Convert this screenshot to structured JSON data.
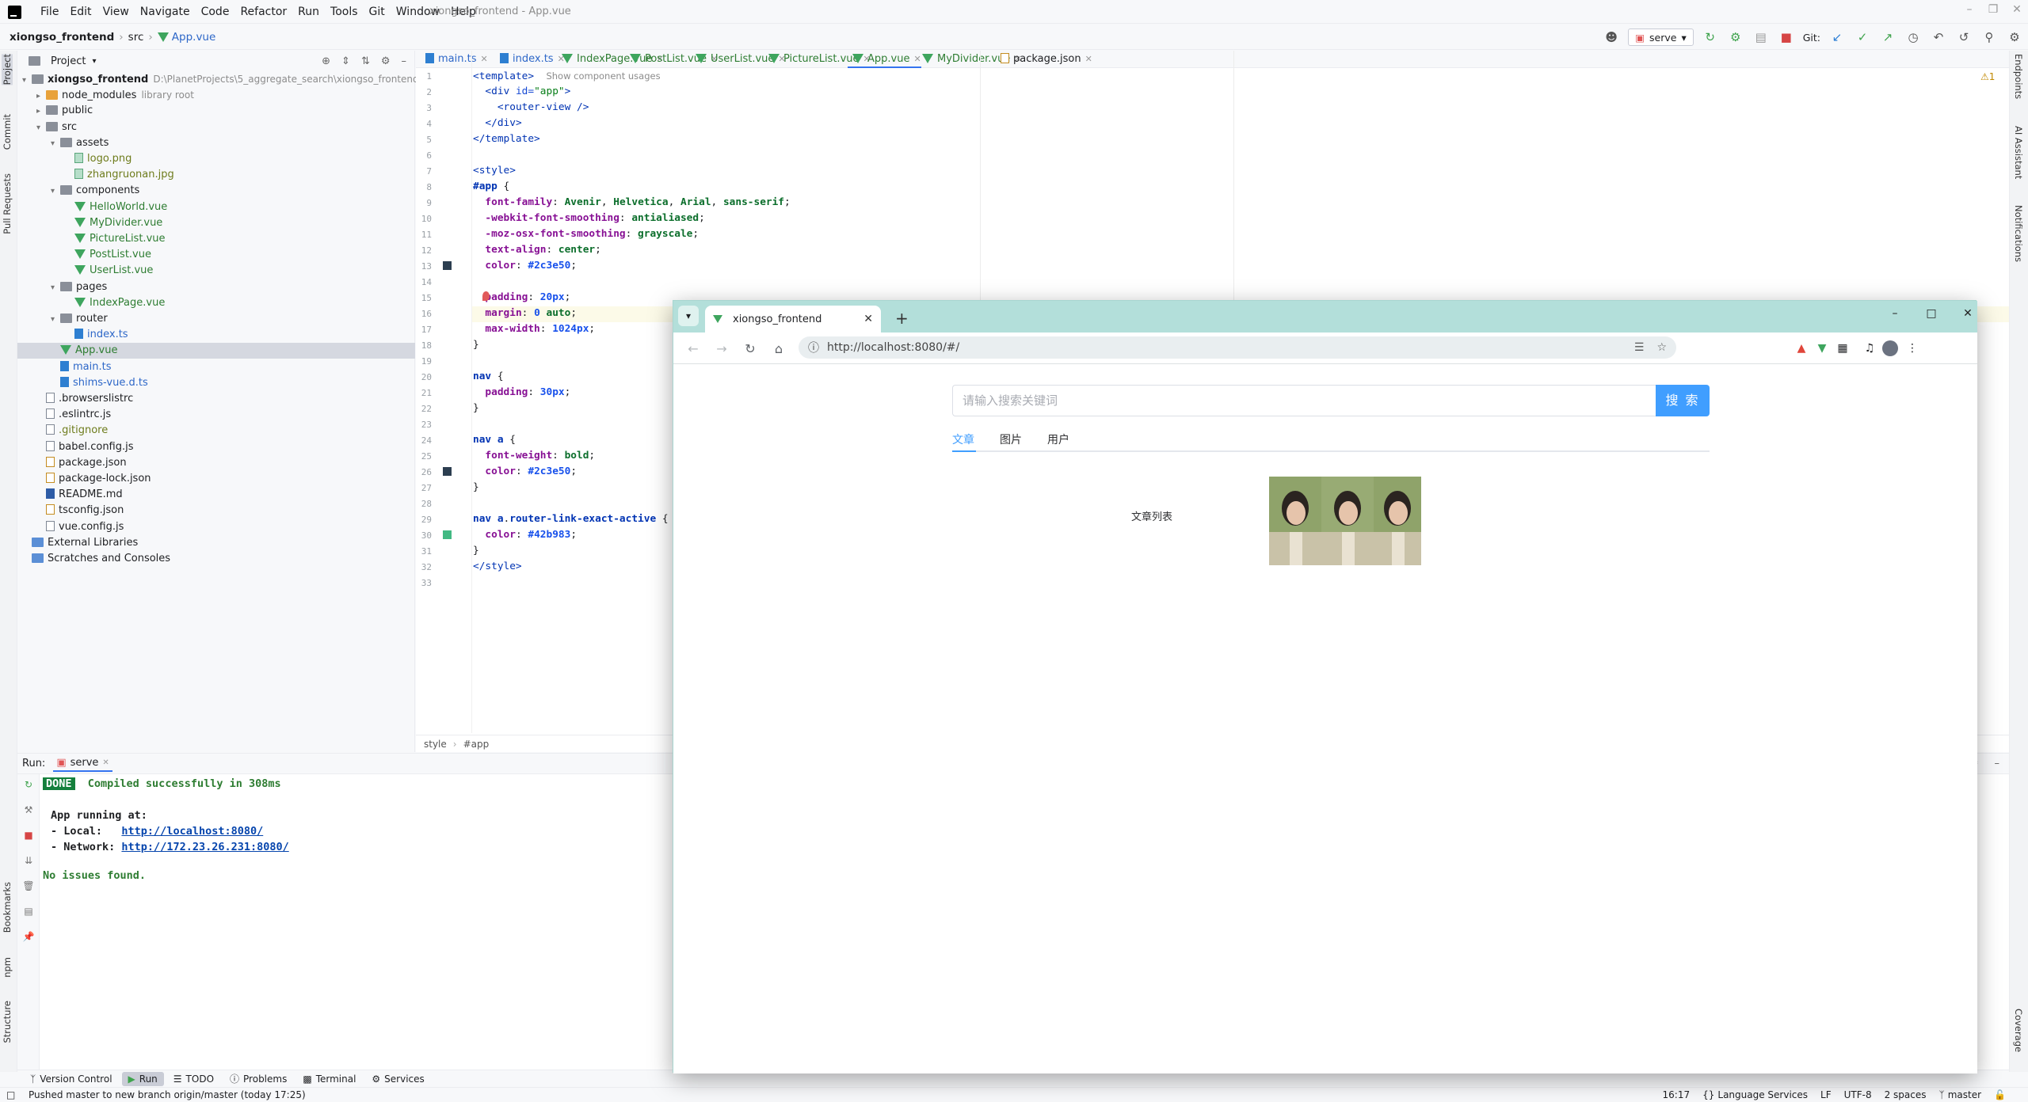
{
  "window": {
    "title": "xiongso_frontend - App.vue"
  },
  "menu": [
    "File",
    "Edit",
    "View",
    "Navigate",
    "Code",
    "Refactor",
    "Run",
    "Tools",
    "Git",
    "Window",
    "Help"
  ],
  "breadcrumb": {
    "project": "xiongso_frontend",
    "folder": "src",
    "file": "App.vue"
  },
  "toolbar": {
    "run_config": "serve",
    "git_label": "Git:"
  },
  "left_stripe": [
    "Project",
    "Commit",
    "Pull Requests",
    "Bookmarks",
    "npm",
    "Structure"
  ],
  "right_stripe": [
    "Endpoints",
    "AI Assistant",
    "Notifications",
    "Coverage"
  ],
  "project_panel": {
    "title": "Project",
    "tree": [
      {
        "label": "xiongso_frontend",
        "extra": "D:\\PlanetProjects\\5_aggregate_search\\xiongso_frontend",
        "type": "root"
      },
      {
        "label": "node_modules",
        "extra": "library root",
        "type": "folder-orange"
      },
      {
        "label": "public",
        "type": "folder"
      },
      {
        "label": "src",
        "type": "folder"
      },
      {
        "label": "assets",
        "type": "folder"
      },
      {
        "label": "logo.png",
        "type": "img"
      },
      {
        "label": "zhangruonan.jpg",
        "type": "img"
      },
      {
        "label": "components",
        "type": "folder"
      },
      {
        "label": "HelloWorld.vue",
        "type": "vue"
      },
      {
        "label": "MyDivider.vue",
        "type": "vue"
      },
      {
        "label": "PictureList.vue",
        "type": "vue"
      },
      {
        "label": "PostList.vue",
        "type": "vue"
      },
      {
        "label": "UserList.vue",
        "type": "vue"
      },
      {
        "label": "pages",
        "type": "folder"
      },
      {
        "label": "IndexPage.vue",
        "type": "vue"
      },
      {
        "label": "router",
        "type": "folder"
      },
      {
        "label": "index.ts",
        "type": "ts"
      },
      {
        "label": "App.vue",
        "type": "vue"
      },
      {
        "label": "main.ts",
        "type": "ts"
      },
      {
        "label": "shims-vue.d.ts",
        "type": "ts"
      },
      {
        "label": ".browserslistrc",
        "type": "file"
      },
      {
        "label": ".eslintrc.js",
        "type": "file"
      },
      {
        "label": ".gitignore",
        "type": "file"
      },
      {
        "label": "babel.config.js",
        "type": "file"
      },
      {
        "label": "package.json",
        "type": "json"
      },
      {
        "label": "package-lock.json",
        "type": "json"
      },
      {
        "label": "README.md",
        "type": "md"
      },
      {
        "label": "tsconfig.json",
        "type": "json"
      },
      {
        "label": "vue.config.js",
        "type": "file"
      },
      {
        "label": "External Libraries",
        "type": "lib"
      },
      {
        "label": "Scratches and Consoles",
        "type": "scratch"
      }
    ]
  },
  "editor_tabs": [
    "main.ts",
    "index.ts",
    "IndexPage.vue",
    "PostList.vue",
    "UserList.vue",
    "PictureList.vue",
    "App.vue",
    "MyDivider.vue",
    "package.json"
  ],
  "editor": {
    "hint": "Show component usages",
    "line_numbers": [
      "1",
      "2",
      "3",
      "4",
      "5",
      "6",
      "7",
      "8",
      "9",
      "10",
      "11",
      "12",
      "13",
      "14",
      "15",
      "16",
      "17",
      "18",
      "19",
      "20",
      "21",
      "22",
      "23",
      "24",
      "25",
      "26",
      "27",
      "28",
      "29",
      "30",
      "31",
      "32",
      "33"
    ],
    "breadcrumb": [
      "style",
      "#app"
    ],
    "warnings": "1"
  },
  "run_panel": {
    "label": "Run:",
    "config": "serve",
    "done_badge": "DONE",
    "compiled": "Compiled successfully in 308ms",
    "app_running": "App running at:",
    "local_label": "- Local:",
    "local_url": "http://localhost:8080/",
    "network_label": "- Network:",
    "network_url": "http://172.23.26.231:8080/",
    "no_issues": "No issues found."
  },
  "bottom_tabs": [
    "Version Control",
    "Run",
    "TODO",
    "Problems",
    "Terminal",
    "Services"
  ],
  "status": {
    "message": "Pushed master to new branch origin/master (today 17:25)",
    "position": "16:17",
    "language_services": "Language Services",
    "line_sep": "LF",
    "encoding": "UTF-8",
    "indent": "2 spaces",
    "branch": "master"
  },
  "browser": {
    "tab_title": "xiongso_frontend",
    "url": "http://localhost:8080/#/",
    "search_placeholder": "请输入搜索关键词",
    "search_button": "搜 索",
    "page_tabs": [
      "文章",
      "图片",
      "用户"
    ],
    "list_label": "文章列表"
  },
  "colors": {
    "accent": "#3574f0",
    "vue_green": "#3ea55e",
    "browser_frame": "#b3dfda",
    "element_blue": "#409eff"
  }
}
